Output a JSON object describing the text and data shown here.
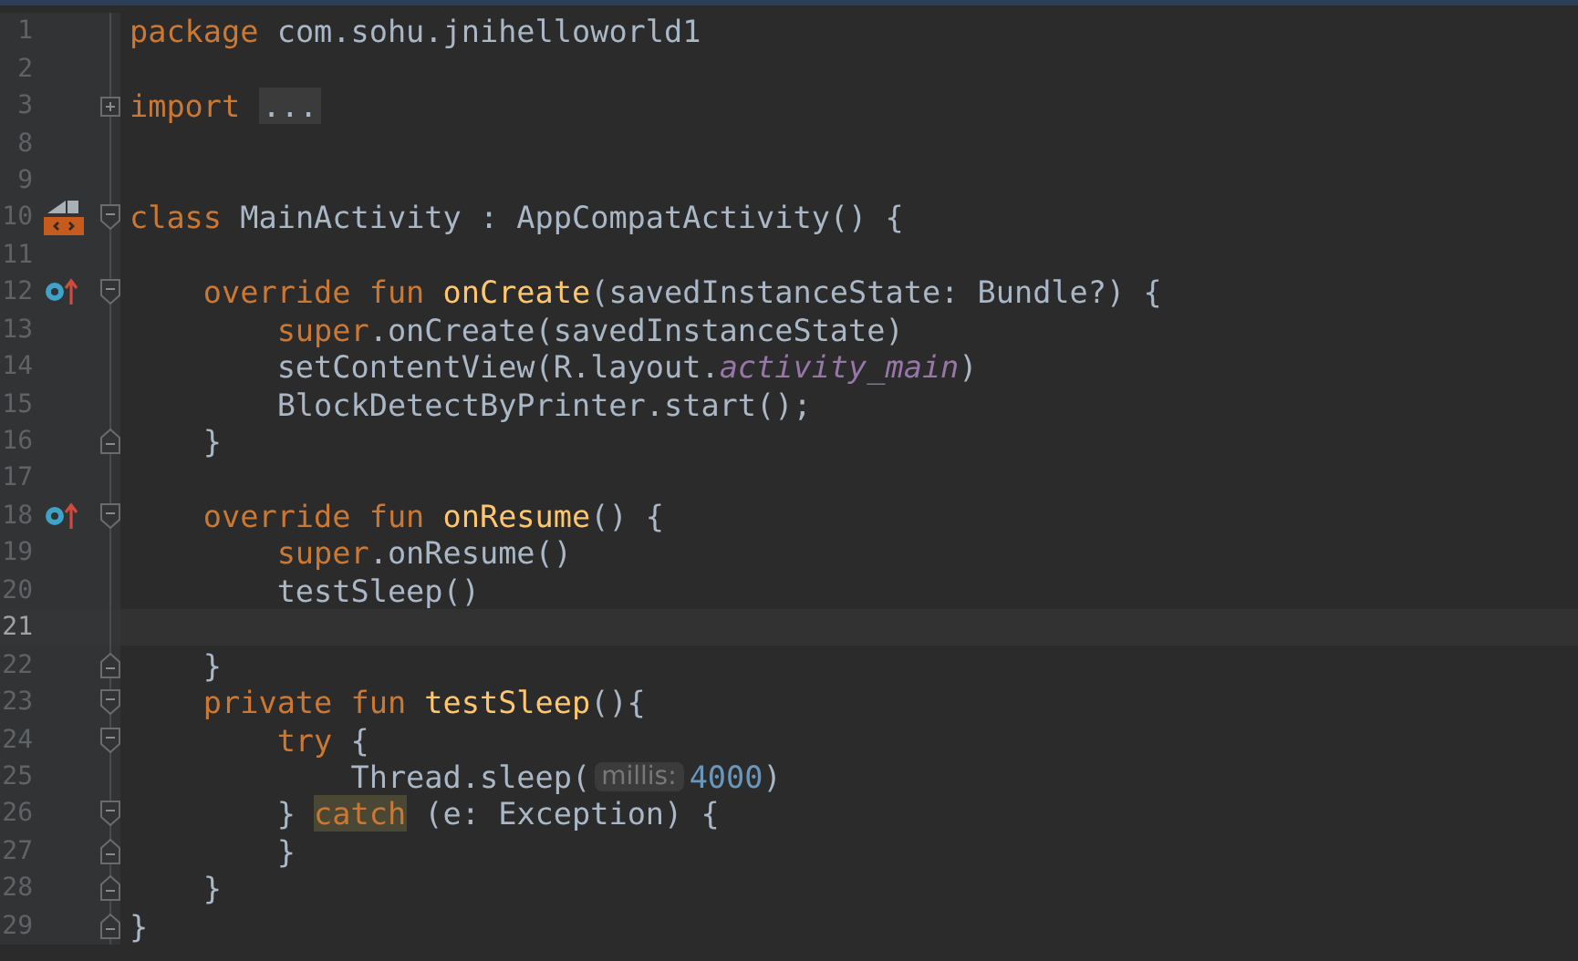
{
  "editor": {
    "lines": [
      {
        "number": "1",
        "current": false,
        "tokens": [
          {
            "kind": "keyword",
            "text": "package"
          },
          {
            "kind": "plain",
            "text": " com.sohu.jnihelloworld1"
          }
        ]
      },
      {
        "number": "2",
        "current": false
      },
      {
        "number": "3",
        "current": false,
        "fold": {
          "kind": "expand"
        },
        "tokens": [
          {
            "kind": "keyword",
            "text": "import "
          },
          {
            "kind": "folded",
            "text": "..."
          }
        ]
      },
      {
        "number": "8",
        "current": false
      },
      {
        "number": "9",
        "current": false
      },
      {
        "number": "10",
        "current": false,
        "gutter_icon": {
          "kind": "layout"
        },
        "fold": {
          "kind": "start"
        },
        "tokens": [
          {
            "kind": "keyword",
            "text": "class"
          },
          {
            "kind": "plain",
            "text": " MainActivity : AppCompatActivity() {"
          }
        ]
      },
      {
        "number": "11",
        "current": false
      },
      {
        "number": "12",
        "current": false,
        "gutter_icon": {
          "kind": "override"
        },
        "fold": {
          "kind": "start"
        },
        "tokens": [
          {
            "kind": "keyword",
            "text": "    override fun "
          },
          {
            "kind": "function",
            "text": "onCreate"
          },
          {
            "kind": "plain",
            "text": "(savedInstanceState: Bundle?) {"
          }
        ]
      },
      {
        "number": "13",
        "current": false,
        "tokens": [
          {
            "kind": "keyword",
            "text": "        super"
          },
          {
            "kind": "plain",
            "text": ".onCreate(savedInstanceState)"
          }
        ]
      },
      {
        "number": "14",
        "current": false,
        "tokens": [
          {
            "kind": "plain",
            "text": "        setContentView(R.layout."
          },
          {
            "kind": "field",
            "text": "activity_main"
          },
          {
            "kind": "plain",
            "text": ")"
          }
        ]
      },
      {
        "number": "15",
        "current": false,
        "tokens": [
          {
            "kind": "plain",
            "text": "        BlockDetectByPrinter.start();"
          }
        ]
      },
      {
        "number": "16",
        "current": false,
        "fold": {
          "kind": "end"
        },
        "tokens": [
          {
            "kind": "plain",
            "text": "    }"
          }
        ]
      },
      {
        "number": "17",
        "current": false
      },
      {
        "number": "18",
        "current": false,
        "gutter_icon": {
          "kind": "override"
        },
        "fold": {
          "kind": "start"
        },
        "tokens": [
          {
            "kind": "keyword",
            "text": "    override fun "
          },
          {
            "kind": "function",
            "text": "onResume"
          },
          {
            "kind": "plain",
            "text": "() {"
          }
        ]
      },
      {
        "number": "19",
        "current": false,
        "tokens": [
          {
            "kind": "keyword",
            "text": "        super"
          },
          {
            "kind": "plain",
            "text": ".onResume()"
          }
        ]
      },
      {
        "number": "20",
        "current": false,
        "tokens": [
          {
            "kind": "plain",
            "text": "        testSleep()"
          }
        ]
      },
      {
        "number": "21",
        "current": true
      },
      {
        "number": "22",
        "current": false,
        "fold": {
          "kind": "end"
        },
        "tokens": [
          {
            "kind": "plain",
            "text": "    }"
          }
        ]
      },
      {
        "number": "23",
        "current": false,
        "fold": {
          "kind": "start"
        },
        "tokens": [
          {
            "kind": "keyword",
            "text": "    private fun "
          },
          {
            "kind": "function",
            "text": "testSleep"
          },
          {
            "kind": "plain",
            "text": "(){"
          }
        ]
      },
      {
        "number": "24",
        "current": false,
        "fold": {
          "kind": "start"
        },
        "tokens": [
          {
            "kind": "keyword",
            "text": "        try"
          },
          {
            "kind": "plain",
            "text": " {"
          }
        ]
      },
      {
        "number": "25",
        "current": false,
        "tokens": [
          {
            "kind": "plain",
            "text": "            Thread.sleep("
          },
          {
            "kind": "hint",
            "text": "millis:"
          },
          {
            "kind": "number",
            "text": "4000"
          },
          {
            "kind": "plain",
            "text": ")"
          }
        ]
      },
      {
        "number": "26",
        "current": false,
        "fold": {
          "kind": "start"
        },
        "tokens": [
          {
            "kind": "plain",
            "text": "        } "
          },
          {
            "kind": "highlight",
            "text": "catch"
          },
          {
            "kind": "plain",
            "text": " (e: Exception) {"
          }
        ]
      },
      {
        "number": "27",
        "current": false,
        "fold": {
          "kind": "end"
        },
        "tokens": [
          {
            "kind": "plain",
            "text": "        }"
          }
        ]
      },
      {
        "number": "28",
        "current": false,
        "fold": {
          "kind": "end"
        },
        "tokens": [
          {
            "kind": "plain",
            "text": "    }"
          }
        ]
      },
      {
        "number": "29",
        "current": false,
        "fold": {
          "kind": "end"
        },
        "tokens": [
          {
            "kind": "plain",
            "text": "}"
          }
        ]
      }
    ]
  }
}
